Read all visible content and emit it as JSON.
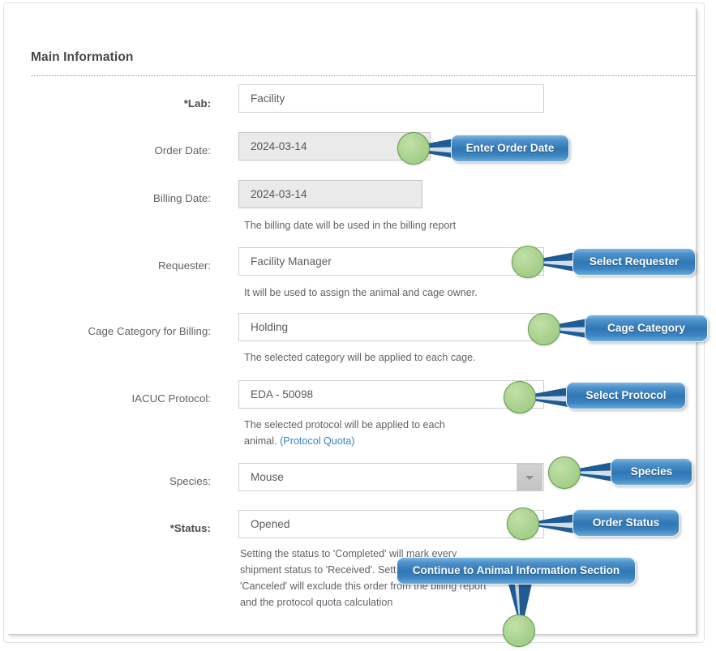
{
  "section": {
    "title": "Main Information"
  },
  "fields": [
    {
      "label": "*Lab:",
      "value": "Facility",
      "help": "",
      "required": true,
      "readonly": false
    },
    {
      "label": "Order Date:",
      "value": "2024-03-14",
      "help": "",
      "required": false,
      "readonly": true
    },
    {
      "label": "Billing Date:",
      "value": "2024-03-14",
      "help": "The billing date will be used in the billing report",
      "required": false,
      "readonly": true
    },
    {
      "label": "Requester:",
      "value": "Facility Manager",
      "help": "It will be used to assign the animal and cage owner.",
      "required": false,
      "readonly": false
    },
    {
      "label": "Cage Category for Billing:",
      "value": "Holding",
      "help": "The selected category will be applied to each cage.",
      "required": false,
      "readonly": false
    },
    {
      "label": "IACUC Protocol:",
      "value": "EDA - 50098",
      "help": "The selected protocol will be applied to each\nanimal. ",
      "help_link": "(Protocol Quota)",
      "required": false,
      "readonly": false
    },
    {
      "label": "Species:",
      "value": "Mouse",
      "help": "",
      "required": false,
      "readonly": false,
      "dropdown": true
    },
    {
      "label": "*Status:",
      "value": "Opened",
      "help": " Setting the status to 'Completed' will mark every\nshipment status to 'Received'. Setting the status to\n'Canceled' will exclude this order from the billing report\nand the protocol quota calculation",
      "required": true,
      "readonly": false
    }
  ],
  "callouts": [
    {
      "label": "Enter Order Date"
    },
    {
      "label": "Select Requester"
    },
    {
      "label": "Cage Category"
    },
    {
      "label": "Select Protocol"
    },
    {
      "label": "Species"
    },
    {
      "label": "Order Status"
    },
    {
      "label": "Continue to Animal  Information Section"
    }
  ],
  "colors": {
    "callout_dark": "#2f76b4",
    "callout_light": "#7fb6e0",
    "marker_green": "#a9d18e",
    "marker_border": "#5d9c45",
    "link_blue": "#3b7fc4",
    "label_gray": "#5f6368"
  }
}
